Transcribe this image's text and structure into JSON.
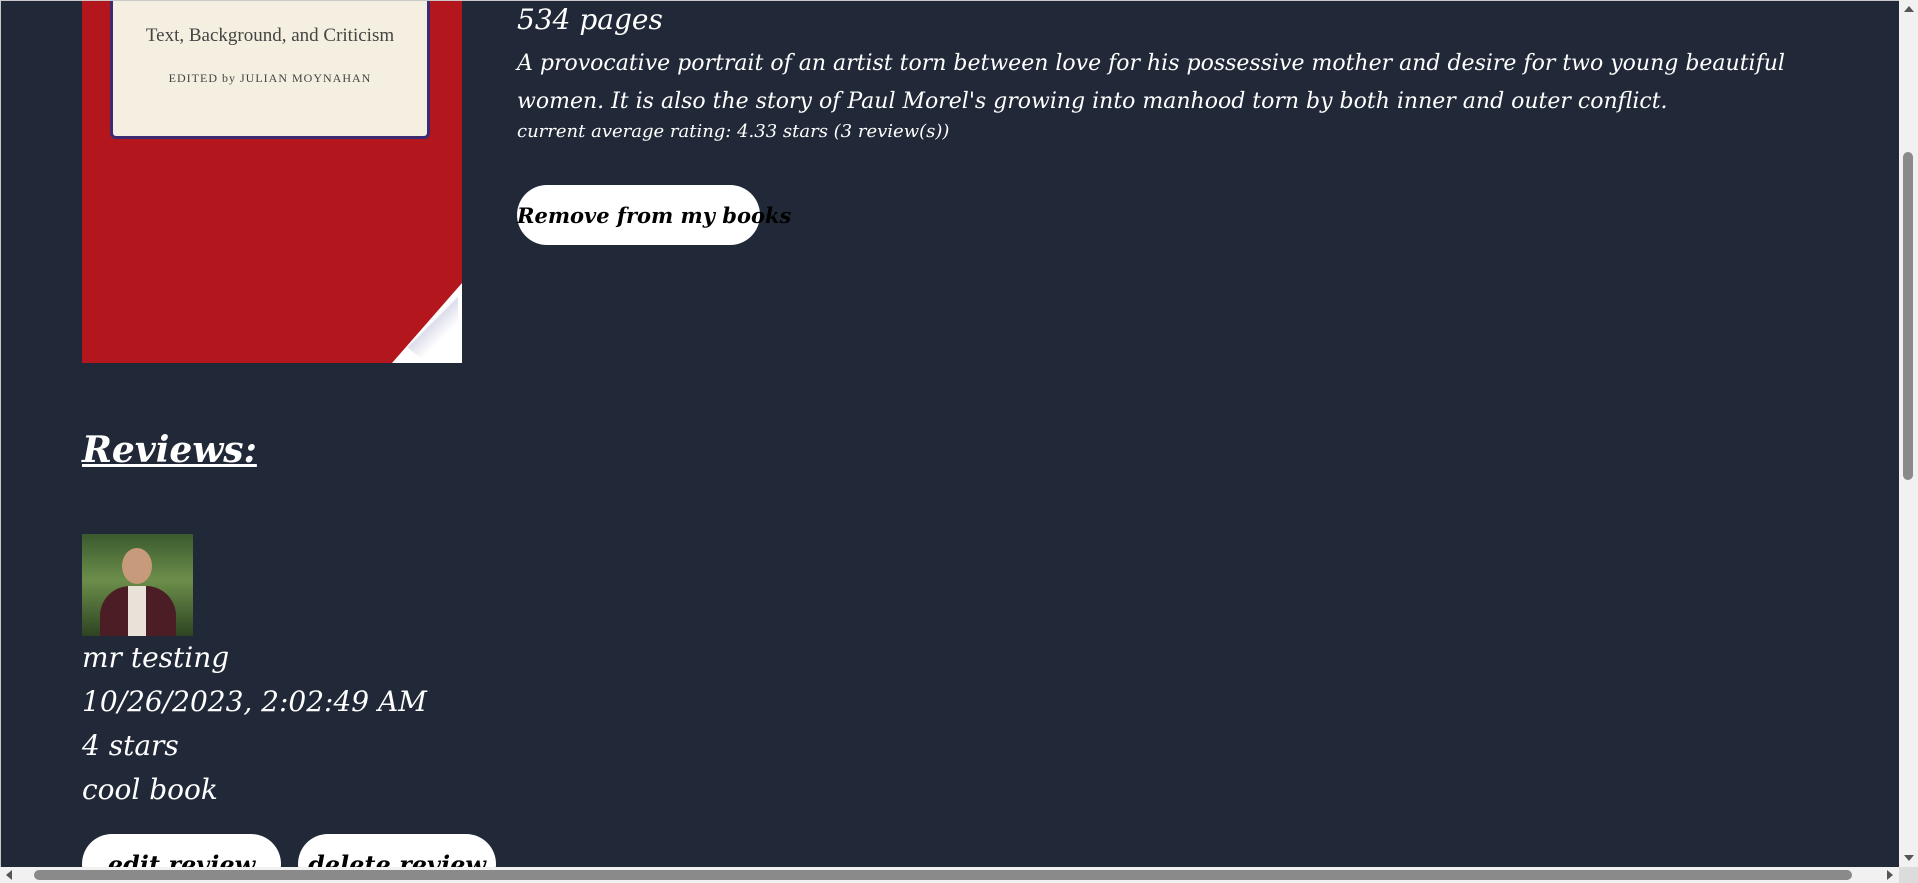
{
  "book": {
    "cover": {
      "subtitle": "Text, Background, and Criticism",
      "editor": "EDITED by JULIAN MOYNAHAN",
      "color": "#b3161d"
    },
    "pages": "534 pages",
    "description": "A provocative portrait of an artist torn between love for his possessive mother and desire for two young beautiful women. It is also the story of Paul Morel's growing into manhood torn by both inner and outer conflict.",
    "rating_text": "current average rating: 4.33 stars (3 review(s))",
    "remove_label": "Remove from my books"
  },
  "reviews": {
    "heading": "Reviews:",
    "items": [
      {
        "username": "mr testing",
        "timestamp": "10/26/2023, 2:02:49 AM",
        "stars": "4 stars",
        "text": "cool book",
        "edit_label": "edit review",
        "delete_label": "delete review"
      }
    ]
  },
  "theme": {
    "background": "#212938",
    "text": "#ffffff",
    "button_bg": "#ffffff",
    "button_text": "#000000"
  }
}
